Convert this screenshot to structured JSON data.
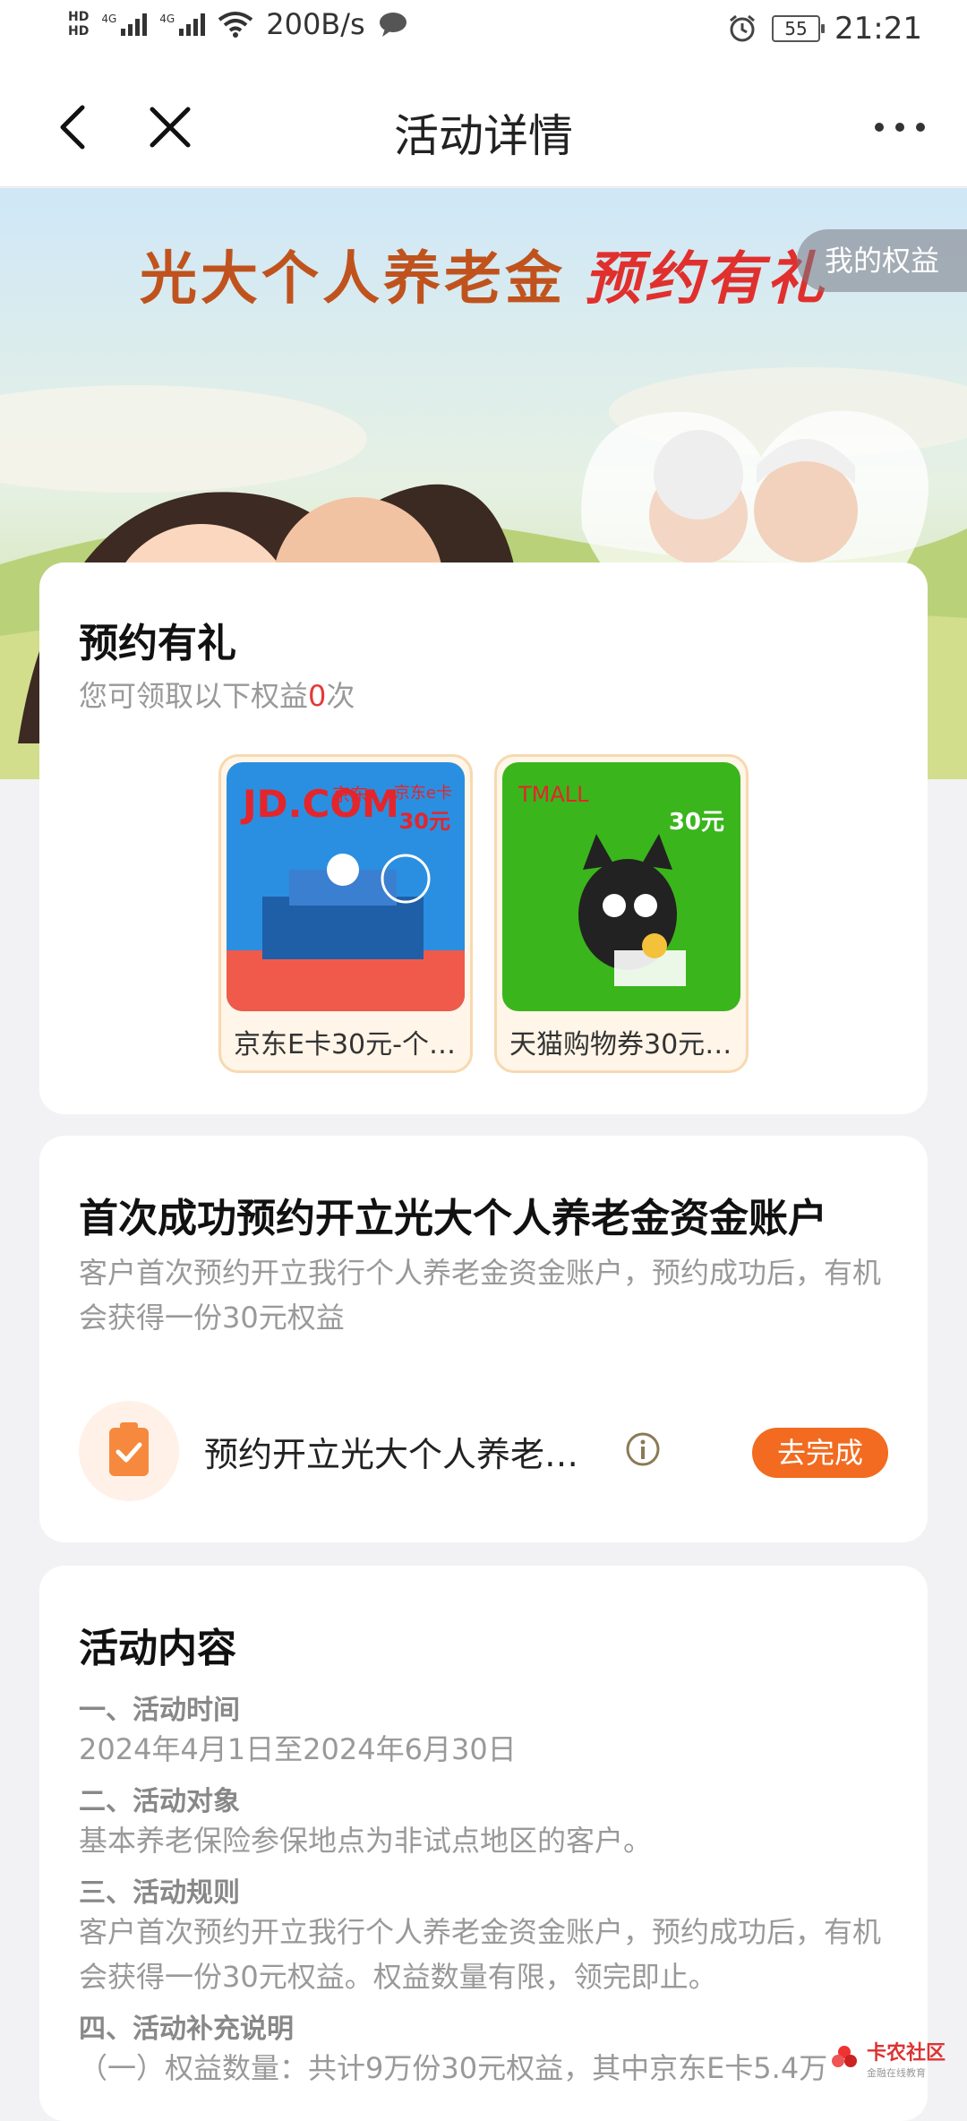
{
  "status_bar": {
    "hd1": "HD",
    "hd2": "HD",
    "net1": "4G",
    "net2": "4G",
    "speed": "200B/s",
    "battery": "55",
    "time": "21:21"
  },
  "nav": {
    "title": "活动详情",
    "back_icon": "chevron-left-icon",
    "close_icon": "close-icon",
    "more_icon": "more-horizontal-icon"
  },
  "banner": {
    "title_main": "光大个人养老金",
    "title_cursive": "预约有礼",
    "my_rights": "我的权益"
  },
  "gift_card": {
    "title": "预约有礼",
    "subtitle_prefix": "您可领取以下权益",
    "count": "0",
    "subtitle_suffix": "次",
    "items": [
      {
        "label": "京东E卡30元-个…",
        "brand": "JD.COM",
        "brand_cn": "京东",
        "card_name": "京东e卡",
        "amount": "30元",
        "color": "#2a8fe0"
      },
      {
        "label": "天猫购物券30元-…",
        "brand": "TMALL",
        "amount": "30元",
        "color": "#3ab51c"
      }
    ]
  },
  "task_card": {
    "title": "首次成功预约开立光大个人养老金资金账户",
    "desc": "客户首次预约开立我行个人养老金资金账户，预约成功后，有机会获得一份30元权益",
    "task_label": "预约开立光大个人养老…",
    "button": "去完成",
    "accent": "#f26b20"
  },
  "content_card": {
    "title": "活动内容",
    "sections": [
      {
        "heading": "一、活动时间",
        "text": "2024年4月1日至2024年6月30日"
      },
      {
        "heading": "二、活动对象",
        "text": "基本养老保险参保地点为非试点地区的客户。"
      },
      {
        "heading": "三、活动规则",
        "text": "客户首次预约开立我行个人养老金资金账户，预约成功后，有机会获得一份30元权益。权益数量有限，领完即止。"
      },
      {
        "heading": "四、活动补充说明",
        "text": "（一）权益数量：共计9万份30元权益，其中京东E卡5.4万"
      }
    ]
  },
  "watermark": {
    "main": "卡农社区",
    "sub": "金融在线教育"
  }
}
